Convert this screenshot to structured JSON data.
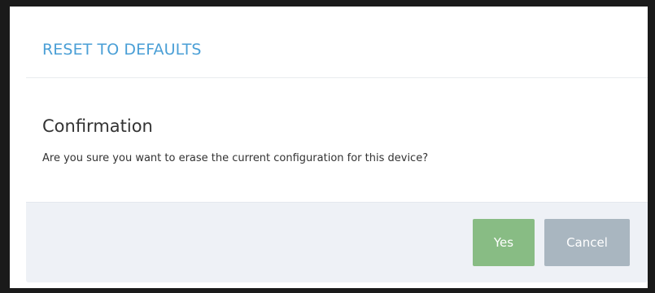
{
  "dialog": {
    "title": "RESET TO DEFAULTS",
    "heading": "Confirmation",
    "message": "Are you sure you want to erase the current configuration for this device?",
    "buttons": {
      "yes_label": "Yes",
      "cancel_label": "Cancel"
    },
    "colors": {
      "title": "#4a9fd6",
      "yes_button": "#88bc84",
      "cancel_button": "#a9b6c0",
      "footer_background": "#eef1f6"
    }
  }
}
